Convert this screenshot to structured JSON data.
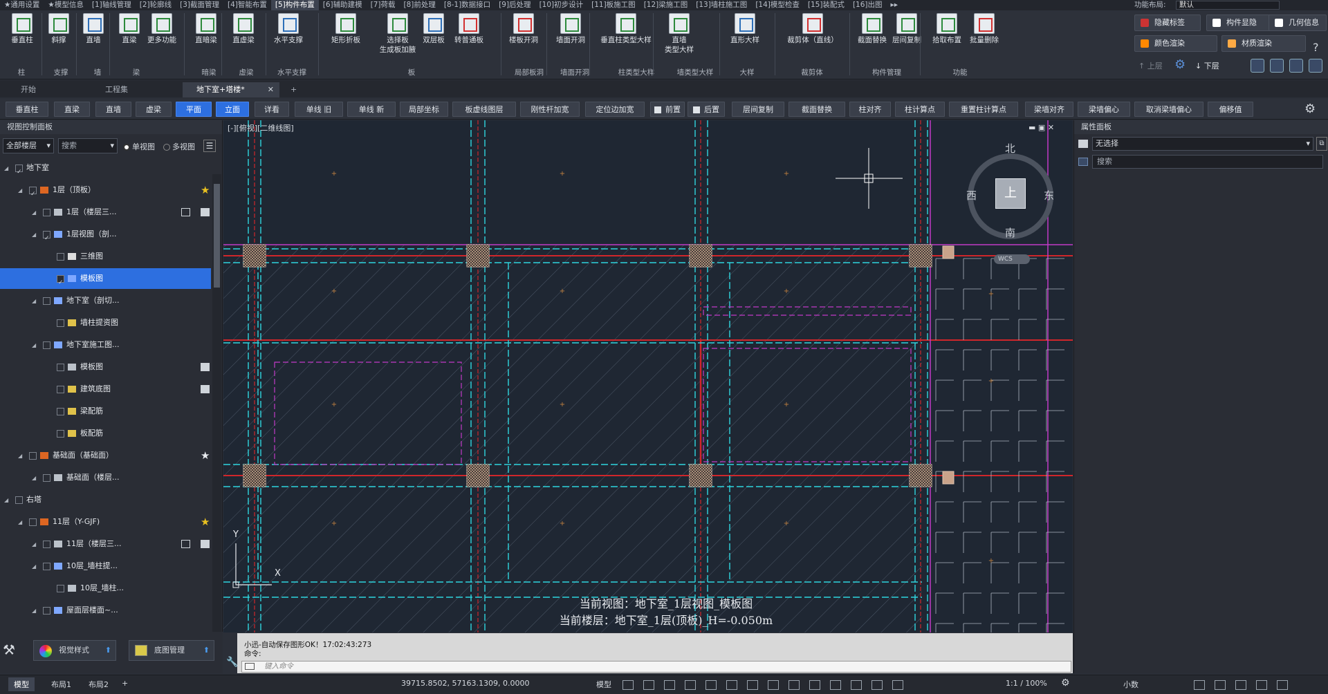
{
  "menu": {
    "items": [
      "★通用设置",
      "★模型信息",
      "[1]轴线管理",
      "[2]轮廓线",
      "[3]截面管理",
      "[4]智能布置",
      "[5]构件布置",
      "[6]辅助建模",
      "[7]荷载",
      "[8]前处理",
      "[8-1]数据接口",
      "[9]后处理",
      "[10]初步设计",
      "[11]板施工图",
      "[12]梁施工图",
      "[13]墙柱施工图",
      "[14]模型检查",
      "[15]装配式",
      "[16]出图"
    ],
    "active_index": 6,
    "more": "▸▸",
    "layout_label": "功能布局:",
    "layout_value": "默认"
  },
  "ribbon": {
    "buttons": [
      {
        "label": "垂直柱",
        "icon": "vertical-column-icon"
      },
      {
        "label": "斜撑",
        "icon": "brace-icon"
      },
      {
        "label": "直墙",
        "icon": "straight-wall-icon"
      },
      {
        "label": "直梁",
        "icon": "straight-beam-icon"
      },
      {
        "label": "更多功能",
        "icon": "more-functions-icon"
      },
      {
        "label": "直暗梁",
        "icon": "hidden-beam-icon"
      },
      {
        "label": "直虚梁",
        "icon": "virtual-beam-icon"
      },
      {
        "label": "水平支撑",
        "icon": "horizontal-brace-icon"
      },
      {
        "label": "矩形折板",
        "icon": "folded-slab-icon"
      },
      {
        "label": "选择板\n生成板加腋",
        "icon": "slab-haunch-icon"
      },
      {
        "label": "双层板",
        "icon": "double-slab-icon"
      },
      {
        "label": "转普通板",
        "icon": "convert-slab-icon"
      },
      {
        "label": "楼板开洞",
        "icon": "slab-opening-icon"
      },
      {
        "label": "墙面开洞",
        "icon": "wall-opening-icon"
      },
      {
        "label": "垂直柱类型大样",
        "icon": "column-detail-icon"
      },
      {
        "label": "直墙\n类型大样",
        "icon": "wall-detail-icon"
      },
      {
        "label": "直形大样",
        "icon": "straight-detail-icon"
      },
      {
        "label": "裁剪体（直线）",
        "icon": "clip-body-icon"
      },
      {
        "label": "截面替换",
        "icon": "section-replace-icon"
      },
      {
        "label": "层间复制",
        "icon": "floor-copy-icon"
      },
      {
        "label": "拾取布置",
        "icon": "pick-place-icon"
      },
      {
        "label": "批量删除",
        "icon": "batch-delete-icon"
      }
    ],
    "groups": [
      "柱",
      "支撑",
      "墙",
      "梁",
      "暗梁",
      "虚梁",
      "水平支撑",
      "板",
      "局部板洞",
      "墙面开洞",
      "柱类型大样",
      "墙类型大样",
      "大样",
      "裁剪体",
      "构件管理",
      "功能"
    ],
    "right": {
      "hide_tags": "隐藏标签",
      "component_show": "构件显隐",
      "geometry_info": "几何信息",
      "color_render": "颜色渲染",
      "material_render": "材质渲染",
      "floor_up": "上层",
      "floor_down": "下层"
    }
  },
  "doctabs": {
    "tabs": [
      "开始",
      "工程集",
      "地下室+塔楼*"
    ],
    "active_index": 2
  },
  "toolbar": {
    "buttons": [
      "垂直柱",
      "直梁",
      "直墙",
      "虚梁",
      "平面",
      "立面",
      "详看",
      "单线 旧",
      "单线 新",
      "局部坐标",
      "板虚线图层",
      "刚性杆加宽",
      "定位边加宽",
      "前置",
      "后置",
      "层间复制",
      "截面替换",
      "柱对齐",
      "柱计算点",
      "重置柱计算点",
      "梁墙对齐",
      "梁墙偏心",
      "取消梁墙偏心",
      "偏移值"
    ],
    "selected": [
      "平面",
      "立面"
    ]
  },
  "leftpanel": {
    "title": "视图控制面板",
    "floor_filter": "全部楼层",
    "search_placeholder": "搜索",
    "view_single": "单视图",
    "view_multi": "多视图",
    "tree": [
      {
        "label": "地下室",
        "level": 0,
        "checked": true,
        "icon": "none"
      },
      {
        "label": "1层（顶板）",
        "level": 1,
        "checked": true,
        "icon": "floor-icon",
        "star": "gold"
      },
      {
        "label": "1层（楼层三...",
        "level": 2,
        "checked": false,
        "icon": "list-icon",
        "extra": true
      },
      {
        "label": "1层视图（剖...",
        "level": 2,
        "checked": true,
        "icon": "view-icon"
      },
      {
        "label": "三维图",
        "level": 3,
        "checked": false,
        "icon": "cube-icon"
      },
      {
        "label": "模板图",
        "level": 3,
        "checked": true,
        "icon": "view-icon",
        "selected": true
      },
      {
        "label": "地下室（剖切...",
        "level": 2,
        "checked": false,
        "icon": "view-icon"
      },
      {
        "label": "墙柱提资图",
        "level": 3,
        "checked": false,
        "icon": "folder-icon"
      },
      {
        "label": "地下室施工图...",
        "level": 2,
        "checked": false,
        "icon": "view-icon"
      },
      {
        "label": "模板图",
        "level": 3,
        "checked": false,
        "icon": "sheet-icon",
        "extra": true
      },
      {
        "label": "建筑底图",
        "level": 3,
        "checked": false,
        "icon": "folder-icon",
        "extra": true
      },
      {
        "label": "梁配筋",
        "level": 3,
        "checked": false,
        "icon": "folder-icon"
      },
      {
        "label": "板配筋",
        "level": 3,
        "checked": false,
        "icon": "folder-icon"
      },
      {
        "label": "基础面（基础面）",
        "level": 1,
        "checked": false,
        "icon": "floor-icon",
        "star": "white"
      },
      {
        "label": "基础面（楼层...",
        "level": 2,
        "checked": false,
        "icon": "list-icon"
      },
      {
        "label": "右塔",
        "level": 0,
        "checked": false,
        "icon": "none"
      },
      {
        "label": "11层（Y-GJF)",
        "level": 1,
        "checked": false,
        "icon": "floor-icon",
        "star": "gold"
      },
      {
        "label": "11层（楼层三...",
        "level": 2,
        "checked": false,
        "icon": "list-icon",
        "extra": true
      },
      {
        "label": "10层_墙柱提...",
        "level": 2,
        "checked": false,
        "icon": "view-icon"
      },
      {
        "label": "10层_墙柱...",
        "level": 3,
        "checked": false,
        "icon": "doc-icon"
      },
      {
        "label": "屋面层楼面~...",
        "level": 2,
        "checked": false,
        "icon": "view-icon"
      }
    ],
    "bottom_buttons": [
      "视觉样式",
      "底图管理"
    ]
  },
  "canvas": {
    "title": "[-][俯视][二维线图]",
    "compass": {
      "north": "北",
      "south": "南",
      "east": "东",
      "west": "西",
      "center": "上",
      "wcs": "WCS"
    },
    "current_view": "当前视图：地下室_1层视图_模板图",
    "current_floor": "当前楼层：地下室_1层(顶板)_H=-0.050m",
    "axis_y": "Y",
    "axis_x": "X"
  },
  "rightpanel": {
    "title": "属性面板",
    "selection": "无选择",
    "search_placeholder": "搜索"
  },
  "command": {
    "line1": "小迅-自动保存图形OK！17:02:43:273",
    "line2": "命令:",
    "input_placeholder": "键入命令"
  },
  "statusbar": {
    "tabs": [
      "模型",
      "布局1",
      "布局2"
    ],
    "active_tab": 0,
    "coords": "39715.8502, 57163.1309, 0.0000",
    "mode": "模型",
    "scale": "1:1 / 100%",
    "decimal": "小数"
  },
  "colors": {
    "accent": "#2d6fe0",
    "canvas_bg": "#1f2733",
    "grid_red": "#d0262a",
    "grid_cyan": "#2fd6e0",
    "magenta": "#c23ac8",
    "column_fill": "#c9a38a"
  }
}
